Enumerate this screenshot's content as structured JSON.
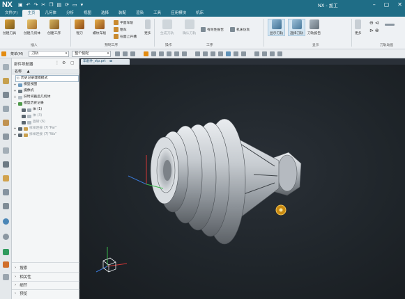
{
  "titlebar": {
    "logo": "NX",
    "window_title": "NX - 加工"
  },
  "menu_tabs": [
    "文件(F)",
    "主页",
    "几何体",
    "分析",
    "视图",
    "选择",
    "装配",
    "渲染",
    "工具",
    "应用模块",
    "机床"
  ],
  "ribbon": {
    "buttons": [
      "创建刀具",
      "创建几何体",
      "创建工序",
      "镗刀",
      "螺纹车削",
      "平面车削",
      "粗车",
      "在面上开槽",
      "更多",
      "生成刀轨",
      "确认刀轨",
      "机床仿真",
      "有效性报告",
      "显示刀轨",
      "选择刀轨",
      "刀轨报告",
      "更多"
    ],
    "groups": [
      "插入",
      "预制工序",
      "操作",
      "工序",
      "显示",
      "刀轨动画"
    ]
  },
  "toolbar": {
    "menu_label": "菜单(M)",
    "filter_value": "刀轨",
    "assembly_value": "整个装配"
  },
  "navigator": {
    "title": "部件导航器",
    "column_header": "名称",
    "tree": [
      {
        "label": "历史记录建模模式",
        "expander": ""
      },
      {
        "label": "模型视图",
        "expander": "+"
      },
      {
        "label": "摄像机",
        "expander": "+"
      },
      {
        "label": "旧时间戳后几何体",
        "expander": "+"
      },
      {
        "label": "模型历史记录",
        "expander": "−"
      },
      {
        "label": "体 (1)",
        "expander": ""
      },
      {
        "label": "体 (3)",
        "expander": ""
      },
      {
        "label": "旋转 (6)",
        "expander": ""
      },
      {
        "label": "拆样连接 (7)\"Par\"",
        "expander": "+"
      },
      {
        "label": "拆样连接 (7)\"Wa\"",
        "expander": "+"
      }
    ],
    "panels": [
      "搜索",
      "相关性",
      "细节",
      "预览"
    ]
  },
  "document_tab": {
    "label": "车削件_stp.prt"
  },
  "colors": {
    "title_bar": "#1f6d86",
    "viewport_bg": "#1f252a",
    "accent": "#e38b10"
  }
}
